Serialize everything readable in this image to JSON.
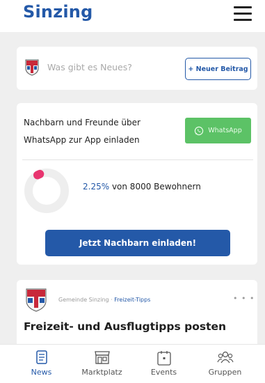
{
  "header": {
    "title": "Sinzing"
  },
  "composer": {
    "placeholder": "Was gibt es Neues?",
    "new_post_label": "+ Neuer Beitrag"
  },
  "invite": {
    "line1": "Nachbarn und Freunde über",
    "line2": "WhatsApp zur App einladen",
    "whatsapp_label": "WhatsApp",
    "percent": "2.25%",
    "residents_text": " von 8000 Bewohnern",
    "progress_fraction": 0.0225,
    "cta_label": "Jetzt Nachbarn einladen!"
  },
  "feed": {
    "author": "Gemeinde Sinzing",
    "separator": " · ",
    "category": "Freizeit-Tipps",
    "more": "• • •",
    "title": "Freizeit- und Ausflugtipps posten"
  },
  "nav": {
    "items": [
      {
        "label": "News",
        "icon": "news-icon"
      },
      {
        "label": "Marktplatz",
        "icon": "marketplace-icon"
      },
      {
        "label": "Events",
        "icon": "calendar-icon"
      },
      {
        "label": "Gruppen",
        "icon": "group-icon"
      }
    ],
    "active_index": 0
  },
  "colors": {
    "brand": "#2459a8",
    "whatsapp": "#5cc266",
    "progress": "#e8356f",
    "background": "#efefef"
  }
}
